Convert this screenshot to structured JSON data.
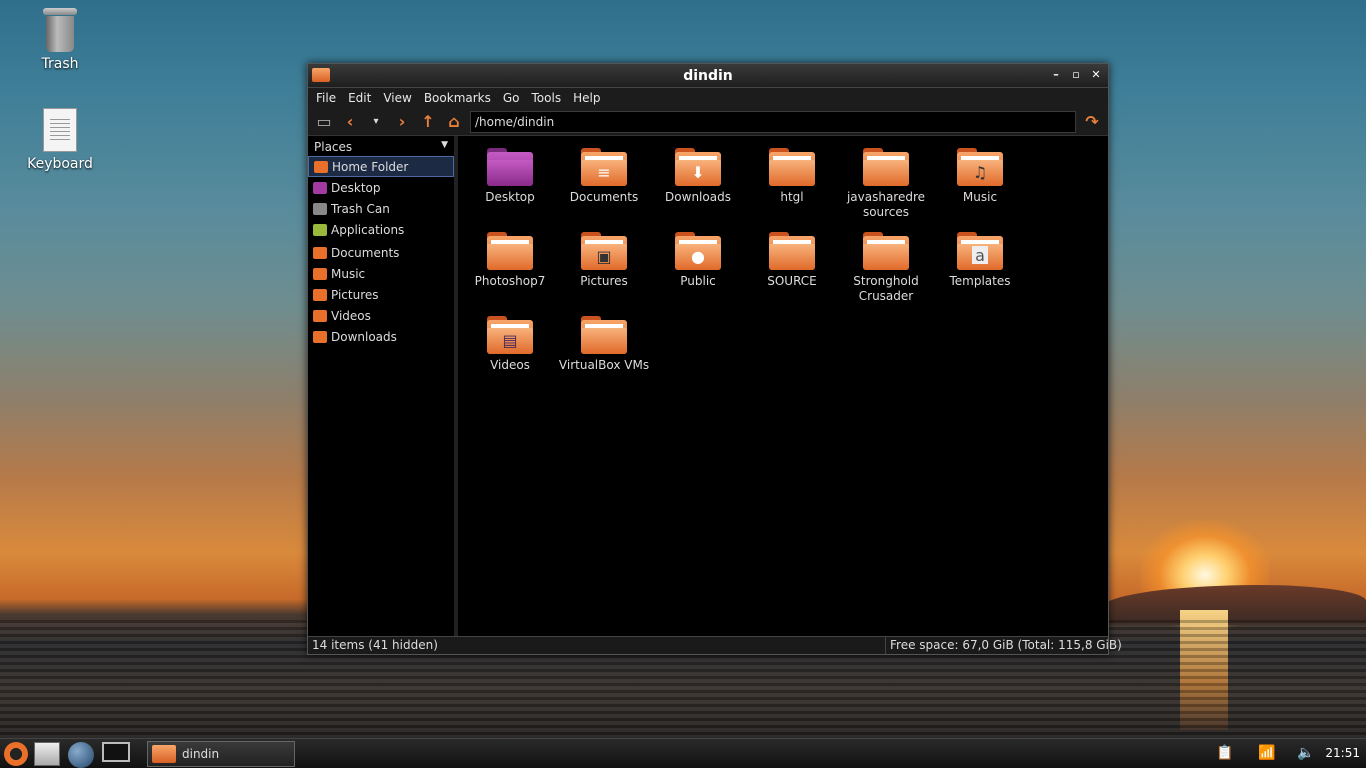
{
  "desktop": {
    "icons": [
      {
        "label": "Trash"
      },
      {
        "label": "Keyboard"
      }
    ]
  },
  "window": {
    "title": "dindin",
    "menu": [
      "File",
      "Edit",
      "View",
      "Bookmarks",
      "Go",
      "Tools",
      "Help"
    ],
    "path": "/home/dindin",
    "sidebar": {
      "header": "Places",
      "items": [
        {
          "label": "Home Folder",
          "color": "#e8702a"
        },
        {
          "label": "Desktop",
          "color": "#a23aa2"
        },
        {
          "label": "Trash Can",
          "color": "#888888"
        },
        {
          "label": "Applications",
          "color": "#9ab83a"
        },
        {
          "label": "Documents",
          "color": "#e8702a"
        },
        {
          "label": "Music",
          "color": "#e8702a"
        },
        {
          "label": "Pictures",
          "color": "#e8702a"
        },
        {
          "label": "Videos",
          "color": "#e8702a"
        },
        {
          "label": "Downloads",
          "color": "#e8702a"
        }
      ]
    },
    "files": [
      {
        "label": "Desktop",
        "emblem": ""
      },
      {
        "label": "Documents",
        "emblem": "≡"
      },
      {
        "label": "Downloads",
        "emblem": "⬇"
      },
      {
        "label": "htgl",
        "emblem": ""
      },
      {
        "label": "javasharedresources",
        "emblem": ""
      },
      {
        "label": "Music",
        "emblem": "♫"
      },
      {
        "label": "Photoshop7",
        "emblem": ""
      },
      {
        "label": "Pictures",
        "emblem": "▣"
      },
      {
        "label": "Public",
        "emblem": "●"
      },
      {
        "label": "SOURCE",
        "emblem": ""
      },
      {
        "label": "Stronghold Crusader",
        "emblem": ""
      },
      {
        "label": "Templates",
        "emblem": "a"
      },
      {
        "label": "Videos",
        "emblem": "▤"
      },
      {
        "label": "VirtualBox VMs",
        "emblem": ""
      }
    ],
    "status_left": "14 items (41 hidden)",
    "status_right": "Free space: 67,0 GiB (Total: 115,8 GiB)"
  },
  "taskbar": {
    "task_label": "dindin",
    "clock": "21:51"
  }
}
